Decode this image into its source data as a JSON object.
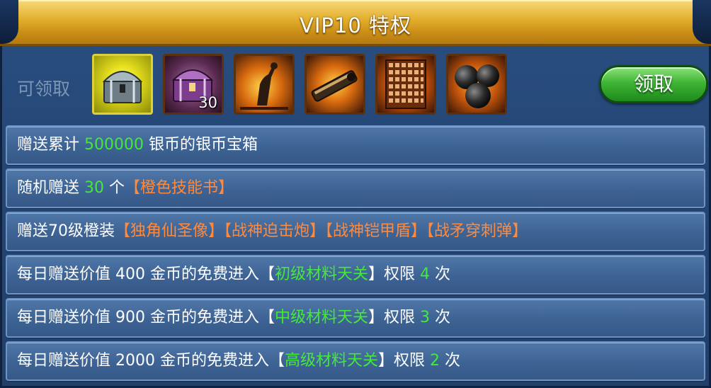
{
  "header": {
    "title": "VIP10 特权"
  },
  "claim": {
    "label": "可领取",
    "button_label": "领取",
    "items": [
      {
        "icon": "silver-chest-icon",
        "count": ""
      },
      {
        "icon": "purple-chest-icon",
        "count": "30"
      },
      {
        "icon": "statue-icon",
        "count": ""
      },
      {
        "icon": "cannon-icon",
        "count": ""
      },
      {
        "icon": "armor-shield-icon",
        "count": ""
      },
      {
        "icon": "cannonballs-icon",
        "count": ""
      }
    ]
  },
  "perks": [
    {
      "p1": "赠送累计 ",
      "amount": "500000",
      "p2": " 银币的银币宝箱"
    },
    {
      "p1": "随机赠送 ",
      "amount": "30",
      "p2": " 个",
      "item": "【橙色技能书】"
    },
    {
      "p1": "赠送70级橙装",
      "items": [
        "【独角仙圣像】",
        "【战神迫击炮】",
        "【战神铠甲盾】",
        "【战矛穿刺弹】"
      ]
    },
    {
      "p1": "每日赠送价值 400 金币的免费进入",
      "bl": "【",
      "stage": "初级材料天关",
      "br": "】",
      "p2": "权限 ",
      "times": "4",
      "p3": " 次"
    },
    {
      "p1": "每日赠送价值 900 金币的免费进入",
      "bl": "【",
      "stage": "中级材料天关",
      "br": "】",
      "p2": "权限 ",
      "times": "3",
      "p3": " 次"
    },
    {
      "p1": "每日赠送价值 2000 金币的免费进入",
      "bl": "【",
      "stage": "高级材料天关",
      "br": "】",
      "p2": "权限 ",
      "times": "2",
      "p3": " 次"
    }
  ],
  "colors": {
    "gold": "#e2ae2c",
    "highlight_green": "#45e83a",
    "highlight_orange": "#ff8a3d",
    "button_green": "#3fb535"
  }
}
